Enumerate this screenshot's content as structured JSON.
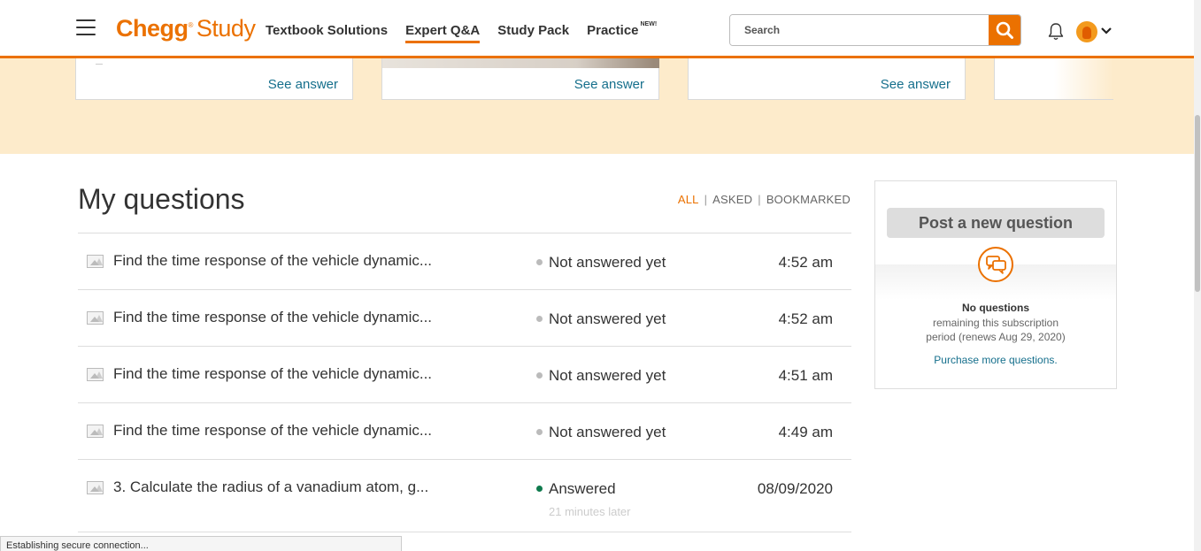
{
  "header": {
    "brand_chegg": "Chegg",
    "brand_reg": "®",
    "brand_study": "Study",
    "nav": [
      {
        "label": "Textbook Solutions"
      },
      {
        "label": "Expert Q&A"
      },
      {
        "label": "Study Pack"
      },
      {
        "label": "Practice",
        "badge": "NEW!"
      }
    ],
    "search_placeholder": "Search"
  },
  "banner": {
    "cards": [
      {
        "link": "See answer"
      },
      {
        "link": "See answer"
      },
      {
        "link": "See answer"
      }
    ]
  },
  "main": {
    "title": "My questions",
    "filters": {
      "all": "ALL",
      "asked": "ASKED",
      "bookmarked": "BOOKMARKED",
      "separator": "|"
    },
    "questions": [
      {
        "text": "Find the time response of the vehicle dynamic...",
        "status": "Not answered yet",
        "time": "4:52 am"
      },
      {
        "text": "Find the time response of the vehicle dynamic...",
        "status": "Not answered yet",
        "time": "4:52 am"
      },
      {
        "text": "Find the time response of the vehicle dynamic...",
        "status": "Not answered yet",
        "time": "4:51 am"
      },
      {
        "text": "Find the time response of the vehicle dynamic...",
        "status": "Not answered yet",
        "time": "4:49 am"
      },
      {
        "text": "3. Calculate the radius of a vanadium atom, g...",
        "status": "Answered",
        "sub": "21 minutes later",
        "time": "08/09/2020"
      }
    ]
  },
  "side": {
    "post_button": "Post a new question",
    "no_questions": "No questions",
    "remaining_line1": "remaining this subscription",
    "remaining_line2": "period (renews Aug 29, 2020)",
    "purchase_link": "Purchase more questions."
  },
  "statusbar": {
    "text": "Establishing secure connection..."
  },
  "colors": {
    "accent": "#eb7100",
    "link": "#156f8c",
    "banner": "#fdebcb",
    "answered": "#0f7a4d"
  }
}
